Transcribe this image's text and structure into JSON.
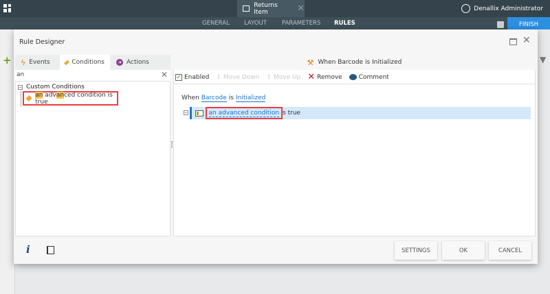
{
  "app": {
    "document_tab": "Returns Item",
    "user": "Denallix Administrator",
    "nav": [
      "GENERAL",
      "LAYOUT",
      "PARAMETERS",
      "RULES"
    ],
    "active_nav": "RULES",
    "finish": "FINISH"
  },
  "dialog": {
    "title": "Rule Designer",
    "tabs": [
      "Events",
      "Conditions",
      "Actions"
    ],
    "active_tab": "Conditions",
    "search": {
      "value": "an"
    },
    "tree": {
      "group": "Custom Conditions",
      "item": {
        "h1": "an",
        "t1": " adv",
        "h2": "an",
        "t2": "ced condition is true"
      }
    },
    "rule_header": "When Barcode is Initialized",
    "toolbar": {
      "enabled": "Enabled",
      "move_down": "Move Down",
      "move_up": "Move Up",
      "remove": "Remove",
      "comment": "Comment"
    },
    "rule": {
      "when": "When",
      "barcode": "Barcode",
      "is": "is",
      "initialized": "Initialized",
      "cond_prefix": "i",
      "cond_link": "an advanced condition",
      "cond_suffix": "s true"
    },
    "footer": {
      "info": "i",
      "settings": "SETTINGS",
      "ok": "OK",
      "cancel": "CANCEL"
    }
  },
  "colors": {
    "accent": "#2d8fe0",
    "highlight": "#f5c150",
    "selection": "#d3e9fb",
    "callout": "#ee3a43"
  }
}
